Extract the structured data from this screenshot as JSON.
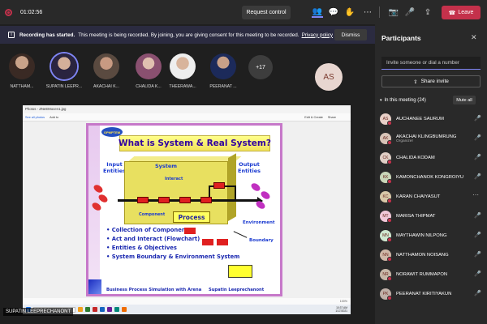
{
  "topbar": {
    "timer": "01:02:56",
    "request_control": "Request control",
    "leave": "Leave",
    "icons": [
      "people-icon",
      "chat-icon",
      "raise-hand-icon",
      "more-icon",
      "camera-off-icon",
      "mic-off-icon",
      "share-icon"
    ]
  },
  "banner": {
    "bold": "Recording has started.",
    "text": "This meeting is being recorded. By joining, you are giving consent for this meeting to be recorded.",
    "link": "Privacy policy",
    "dismiss": "Dismiss"
  },
  "strip": {
    "participants": [
      {
        "name": "NATTHAM..."
      },
      {
        "name": "SUPATIN LEEPR..."
      },
      {
        "name": "AKACHAI K..."
      },
      {
        "name": "CHALIDA K..."
      },
      {
        "name": "THEERAWA..."
      },
      {
        "name": "PEERANAT ..."
      }
    ],
    "more": "+17",
    "self_initials": "AS"
  },
  "screen": {
    "window_title": "Photos - ZNeEMocen1.jpg",
    "tools": [
      "See all photos",
      "Add to",
      "Edit & Create",
      "Share"
    ],
    "slide": {
      "logo": "OPMPTEM",
      "title": "What is System & Real System?",
      "input": "Input\nEntities",
      "system": "System",
      "interact": "Interact",
      "component": "Component",
      "output": "Output\nEntities",
      "process": "Process",
      "environment": "Environment",
      "boundary": "Boundary",
      "bullets": [
        "• Collection of Components",
        "• Act and Interact (Flowchart)",
        "• Entities & Objectives",
        "• System Boundary & Environment System"
      ],
      "footer_left": "Business Process Simulation with Arena",
      "footer_right": "Supatin Leeprechanont"
    },
    "status": "100%",
    "taskbar": {
      "search": "Type here to search",
      "time": "10:37 AM",
      "date": "1/17/2021"
    }
  },
  "presenter": "SUPATIN LEEPRECHANONT",
  "panel": {
    "title": "Participants",
    "invite_placeholder": "Invite someone or dial a number",
    "share_invite": "Share invite",
    "section": "In this meeting (24)",
    "mute_all": "Mute all",
    "people": [
      {
        "initials": "AS",
        "name": "AUCHANEE SAURUM",
        "sub": "",
        "color": "#e8d0c8"
      },
      {
        "initials": "AK",
        "name": "AKACHAI KLINGBUMRUNG",
        "sub": "Organizer",
        "color": "#d8c4b8"
      },
      {
        "initials": "CK",
        "name": "CHALIDA KODAM",
        "sub": "",
        "color": "#e0cfc6"
      },
      {
        "initials": "KK",
        "name": "KAMONCHANOK KONGROIYU",
        "sub": "",
        "color": "#c9d6b8"
      },
      {
        "initials": "KC",
        "name": "KARAN CHAIYASUT",
        "sub": "",
        "color": "#d8c8a8"
      },
      {
        "initials": "MT",
        "name": "MARISA THIPMAT",
        "sub": "",
        "color": "#f0c8d8"
      },
      {
        "initials": "MN",
        "name": "MAYTHAWIN NILPONG",
        "sub": "",
        "color": "#cfe8d0"
      },
      {
        "initials": "NN",
        "name": "NATTHAMON NOISANG",
        "sub": "",
        "color": "#d0b8a8"
      },
      {
        "initials": "NR",
        "name": "NORAWIT RUMMAPON",
        "sub": "",
        "color": "#c8b8a8"
      },
      {
        "initials": "PK",
        "name": "PEERANAT KIRITIYAKUN",
        "sub": "",
        "color": "#c0b0a8"
      }
    ]
  }
}
